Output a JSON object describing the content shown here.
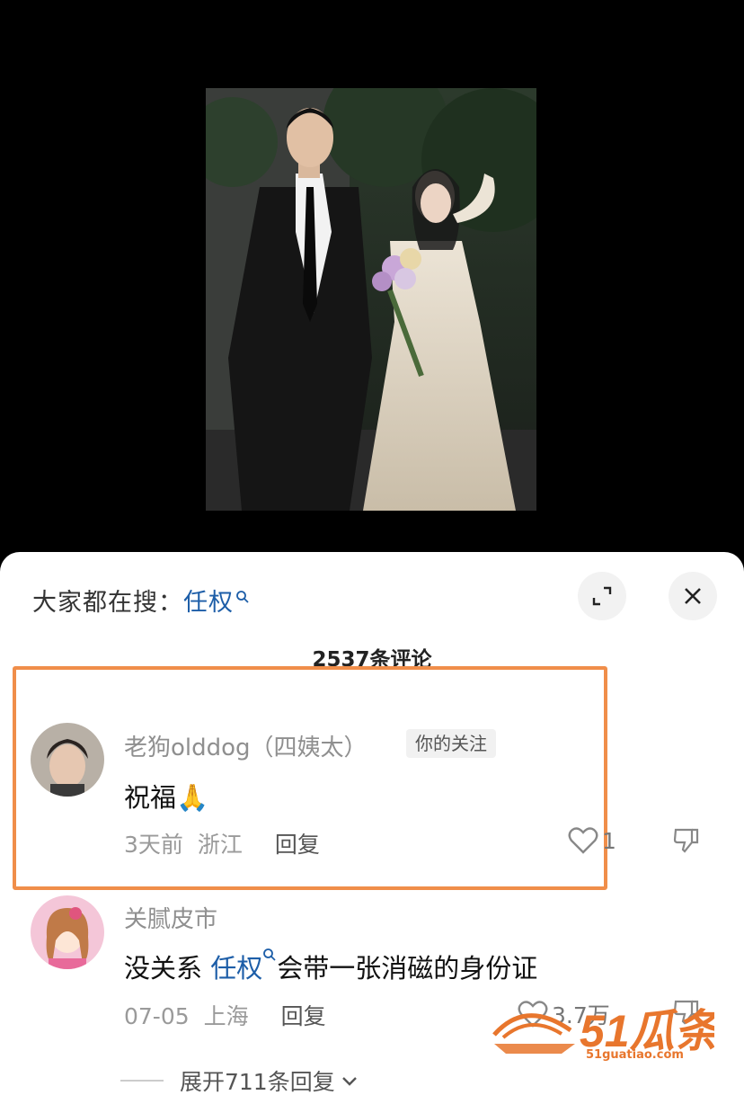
{
  "search_bar": {
    "prefix": "大家都在搜：",
    "keyword": "任权"
  },
  "comment_count": "2537条评论",
  "comments": [
    {
      "username": "老狗olddog（四姨太）",
      "tag": "你的关注",
      "text": "祝福🙏",
      "time": "3天前",
      "location": "浙江",
      "reply": "回复",
      "likes": "1"
    },
    {
      "username": "关腻皮市",
      "text_before": "没关系 ",
      "keyword": "任权",
      "text_after": "会带一张消磁的身份证",
      "time": "07-05",
      "location": "上海",
      "reply": "回复",
      "likes": "3.7万"
    }
  ],
  "expand_replies": "展开711条回复",
  "watermark": {
    "logo": "51瓜条",
    "url": "51guatiao.com"
  },
  "colors": {
    "accent_blue": "#1d5ea8",
    "highlight_orange": "#f08e4a",
    "watermark_orange": "#e8762d"
  }
}
